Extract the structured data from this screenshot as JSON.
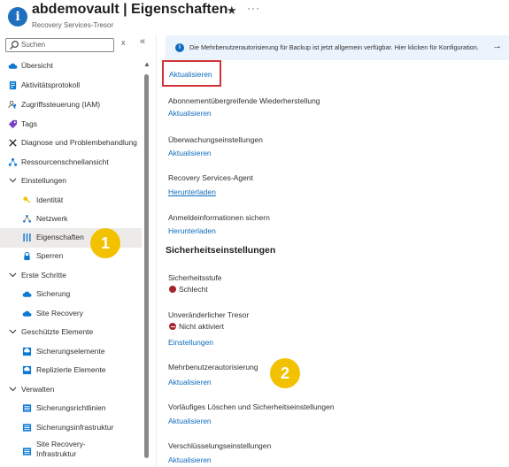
{
  "header": {
    "title": "abdemovault | Eigenschaften",
    "subtitle": "Recovery Services-Tresor",
    "info_glyph": "i",
    "star_glyph": "★",
    "more_glyph": "···"
  },
  "search": {
    "placeholder": "Suchen",
    "clear_glyph": "x",
    "collapse_glyph": "«"
  },
  "sidebar": {
    "items": [
      {
        "label": "Übersicht",
        "icon": "cloud-icon"
      },
      {
        "label": "Aktivitätsprotokoll",
        "icon": "log-icon"
      },
      {
        "label": "Zugriffssteuerung (IAM)",
        "icon": "people-icon"
      },
      {
        "label": "Tags",
        "icon": "tag-icon"
      },
      {
        "label": "Diagnose und Problembehandlung",
        "icon": "wrench-icon"
      },
      {
        "label": "Ressourcenschnellansicht",
        "icon": "network-icon"
      },
      {
        "label": "Einstellungen",
        "group": true
      },
      {
        "label": "Identität",
        "icon": "identity-icon"
      },
      {
        "label": "Netzwerk",
        "icon": "network-icon"
      },
      {
        "label": "Eigenschaften",
        "icon": "properties-icon",
        "selected": true
      },
      {
        "label": "Sperren",
        "icon": "lock-icon"
      },
      {
        "label": "Erste Schritte",
        "group": true
      },
      {
        "label": "Sicherung",
        "icon": "cloud-icon"
      },
      {
        "label": "Site Recovery",
        "icon": "cloud-icon"
      },
      {
        "label": "Geschützte Elemente",
        "group": true
      },
      {
        "label": "Sicherungselemente",
        "icon": "backup-items-icon"
      },
      {
        "label": "Replizierte Elemente",
        "icon": "replicated-items-icon"
      },
      {
        "label": "Verwalten",
        "group": true
      },
      {
        "label": "Sicherungsrichtlinien",
        "icon": "policy-icon"
      },
      {
        "label": "Sicherungsinfrastruktur",
        "icon": "infrastructure-icon"
      },
      {
        "label": "Site Recovery-Infrastruktur",
        "icon": "infrastructure-icon"
      }
    ],
    "scroll_up_glyph": "▲"
  },
  "banner": {
    "text": "Die Mehrbenutzerautorisierung für Backup ist jetzt allgemein verfügbar. Hier klicken für Konfiguration.",
    "arrow": "→"
  },
  "main": {
    "top_link": "Aktualisieren",
    "sections": [
      {
        "label": "Abonnementübergreifende Wiederherstellung",
        "link": "Aktualisieren"
      },
      {
        "label": "Überwachungseinstellungen",
        "link": "Aktualisieren"
      },
      {
        "label": "Recovery Services-Agent",
        "link": "Herunterladen"
      },
      {
        "label": "Anmeldeinformationen sichern",
        "link": "Herunterladen"
      }
    ],
    "security_heading": "Sicherheitseinstellungen",
    "security_level": {
      "label": "Sicherheitsstufe",
      "status": "Schlecht"
    },
    "immutable": {
      "label": "Unveränderlicher Tresor",
      "status": "Nicht aktiviert",
      "link": "Einstellungen"
    },
    "mua": {
      "label": "Mehrbenutzerautorisierung",
      "link": "Aktualisieren"
    },
    "soft_delete": {
      "label": "Vorläufiges Löschen und Sicherheitseinstellungen",
      "link": "Aktualisieren"
    },
    "encryption": {
      "label": "Verschlüsselungseinstellungen",
      "link": "Aktualisieren"
    }
  },
  "badges": {
    "one": "1",
    "two": "2"
  },
  "colors": {
    "accent": "#0f6cbd",
    "badge": "#f2c200",
    "highlight_border": "#d13438",
    "error": "#a4262c"
  }
}
